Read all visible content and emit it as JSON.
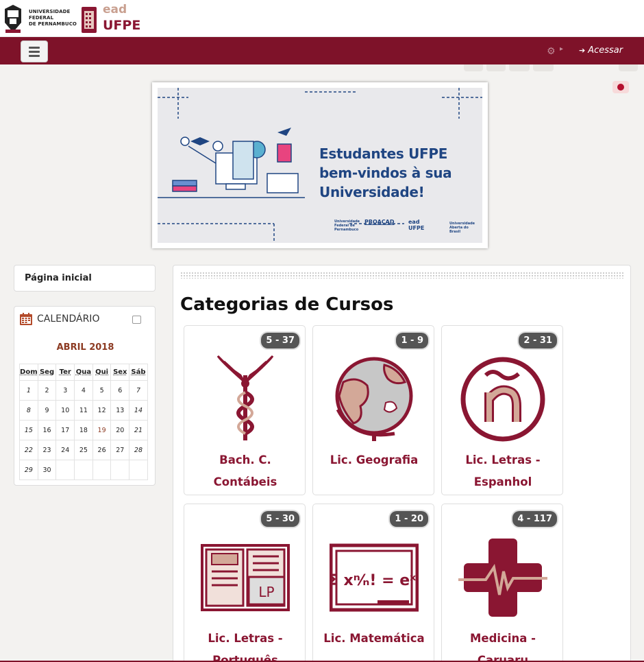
{
  "header": {
    "university_name_line1": "Universidade",
    "university_name_line2": "Federal",
    "university_name_line3": "de Pernambuco",
    "ead_label": "ead",
    "ufpe_label": "UFPE"
  },
  "navbar": {
    "login_label": "Acessar"
  },
  "banner": {
    "line1": "Estudantes UFPE",
    "line2": "bem-vindos à sua",
    "line3": "Universidade!",
    "partner_ufpe": "Universidade Federal de Pernambuco",
    "partner_proacad": "PROACAD",
    "partner_ead": "ead UFPE",
    "partner_uab": "Universidade Aberta do Brasil"
  },
  "sidebar": {
    "home_link": "Página inicial",
    "calendar_title": "CALENDÁRIO",
    "calendar_month": "ABRIL 2018",
    "weekdays": [
      "Dom",
      "Seg",
      "Ter",
      "Qua",
      "Qui",
      "Sex",
      "Sáb"
    ],
    "weeks": [
      [
        "1",
        "2",
        "3",
        "4",
        "5",
        "6",
        "7"
      ],
      [
        "8",
        "9",
        "10",
        "11",
        "12",
        "13",
        "14"
      ],
      [
        "15",
        "16",
        "17",
        "18",
        "19",
        "20",
        "21"
      ],
      [
        "22",
        "23",
        "24",
        "25",
        "26",
        "27",
        "28"
      ],
      [
        "29",
        "30",
        "",
        "",
        "",
        "",
        ""
      ]
    ],
    "today": "19"
  },
  "main": {
    "title": "Categorias de Cursos",
    "categories": [
      {
        "label": "Bach. C. Contábeis",
        "badge": "5 - 37",
        "icon": "caduceus-icon"
      },
      {
        "label": "Lic. Geografia",
        "badge": "1 - 9",
        "icon": "globe-icon"
      },
      {
        "label": "Lic. Letras - Espanhol",
        "badge": "2 - 31",
        "icon": "enye-icon"
      },
      {
        "label": "Lic. Letras - Português",
        "badge": "5 - 30",
        "icon": "book-lp-icon"
      },
      {
        "label": "Lic. Matemática",
        "badge": "1 - 20",
        "icon": "math-board-icon"
      },
      {
        "label": "Medicina - Caruaru",
        "badge": "4 - 117",
        "icon": "medical-cross-icon"
      }
    ]
  },
  "colors": {
    "brand": "#7e1229",
    "accent": "#c9a090"
  }
}
